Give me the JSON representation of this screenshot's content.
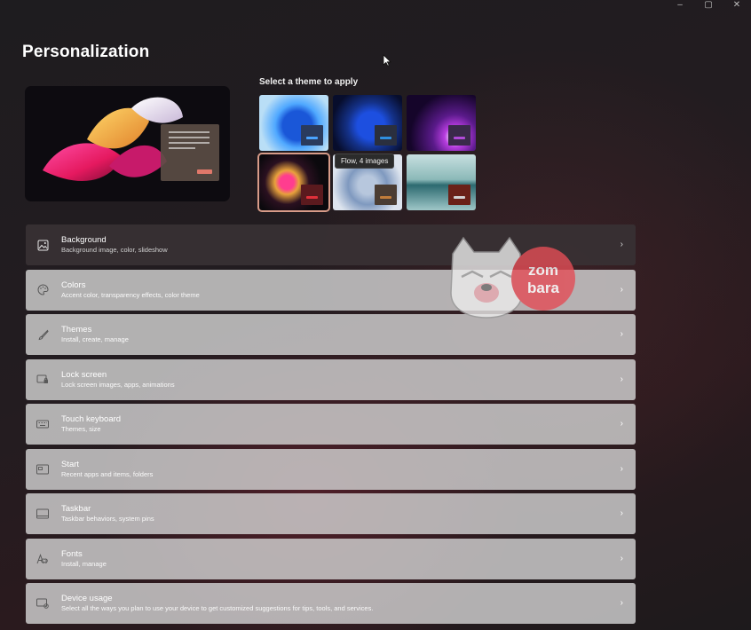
{
  "window": {
    "minimize": "–",
    "maximize": "▢",
    "close": "✕"
  },
  "page": {
    "title": "Personalization"
  },
  "themes": {
    "label": "Select a theme to apply",
    "tooltip": "Flow, 4 images",
    "tiles": [
      {
        "name": "theme-windows-light",
        "window_color": "#2a3b5e",
        "bar_color": "#4aa3ff"
      },
      {
        "name": "theme-windows-dark",
        "window_color": "#2a2f3e",
        "bar_color": "#2f8fe0"
      },
      {
        "name": "theme-glow",
        "window_color": "#3a2a4a",
        "bar_color": "#b04ad8"
      },
      {
        "name": "theme-flow",
        "window_color": "#5a1a1e",
        "bar_color": "#e0303a"
      },
      {
        "name": "theme-sunrise",
        "window_color": "#4b3d33",
        "bar_color": "#c27d3a"
      },
      {
        "name": "theme-captured-motion",
        "window_color": "#6a2118",
        "bar_color": "#d2d2d2"
      }
    ]
  },
  "settings": [
    {
      "title": "Background",
      "subtitle": "Background image, color, slideshow",
      "icon": "image-icon"
    },
    {
      "title": "Colors",
      "subtitle": "Accent color, transparency effects, color theme",
      "icon": "palette-icon"
    },
    {
      "title": "Themes",
      "subtitle": "Install, create, manage",
      "icon": "brush-icon"
    },
    {
      "title": "Lock screen",
      "subtitle": "Lock screen images, apps, animations",
      "icon": "lock-screen-icon"
    },
    {
      "title": "Touch keyboard",
      "subtitle": "Themes, size",
      "icon": "keyboard-icon"
    },
    {
      "title": "Start",
      "subtitle": "Recent apps and items, folders",
      "icon": "start-icon"
    },
    {
      "title": "Taskbar",
      "subtitle": "Taskbar behaviors, system pins",
      "icon": "taskbar-icon"
    },
    {
      "title": "Fonts",
      "subtitle": "Install, manage",
      "icon": "fonts-icon"
    },
    {
      "title": "Device usage",
      "subtitle": "Select all the ways you plan to use your device to get customized suggestions for tips, tools, and services.",
      "icon": "device-usage-icon"
    }
  ],
  "chevron": "›",
  "watermark": {
    "line1": "zom",
    "line2": "bara"
  }
}
